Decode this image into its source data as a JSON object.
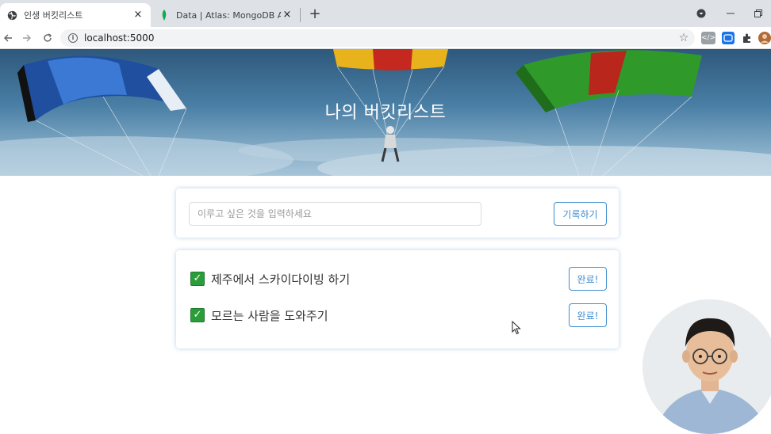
{
  "browser": {
    "tabs": [
      {
        "title": "인생 버킷리스트",
        "active": true,
        "icon": "globe-icon"
      },
      {
        "title": "Data | Atlas: MongoDB Atlas",
        "active": false,
        "icon": "mongodb-leaf-icon"
      }
    ],
    "close_glyph": "×",
    "new_tab_glyph": "+",
    "url": "localhost:5000",
    "info_glyph": "i",
    "extension_labels": {
      "devtools": "</>"
    }
  },
  "page": {
    "title": "나의 버킷리스트",
    "input_placeholder": "이루고 싶은 것을 입력하세요",
    "input_value": "",
    "save_label": "기록하기",
    "items": [
      {
        "text": "제주에서 스카이다이빙 하기",
        "done_label": "완료!",
        "checked": true
      },
      {
        "text": "모르는 사람을 도와주기",
        "done_label": "완료!",
        "checked": true
      }
    ]
  },
  "colors": {
    "accent": "#3e8ed0",
    "check": "#2a9d3a",
    "tabbar": "#dee1e6"
  }
}
